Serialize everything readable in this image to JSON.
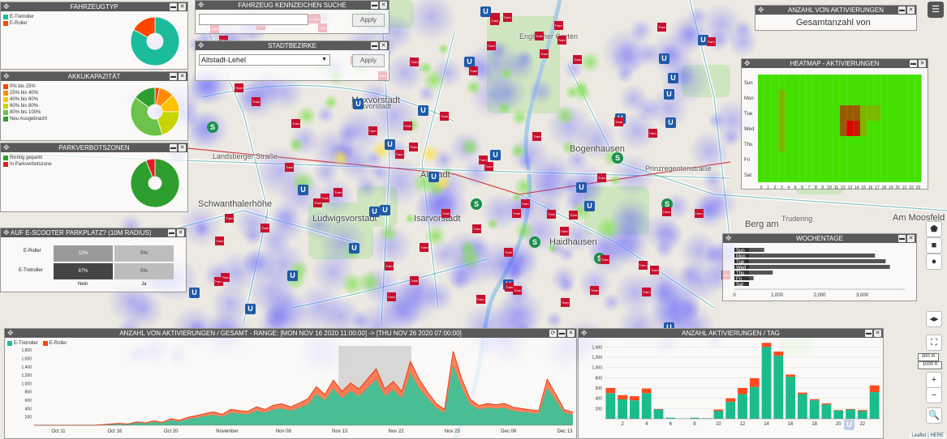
{
  "panels": {
    "vehicle_type": {
      "title": "FAHRZEUGTYP",
      "legend": [
        {
          "label": "E-Tretroller",
          "color": "#1abc9c"
        },
        {
          "label": "E-Roller",
          "color": "#ff4500"
        }
      ]
    },
    "battery": {
      "title": "AKKUKAPAZITÄT",
      "legend": [
        {
          "label": "0% bis 25%",
          "color": "#ff4500"
        },
        {
          "label": "25% bis 40%",
          "color": "#ff8c00"
        },
        {
          "label": "40% bis 60%",
          "color": "#ffc300"
        },
        {
          "label": "60% bis 80%",
          "color": "#c8d400"
        },
        {
          "label": "80% bis 100%",
          "color": "#6cc24a"
        },
        {
          "label": "Neu Ausgebracht",
          "color": "#2e9e2e"
        }
      ]
    },
    "parking_zones": {
      "title": "PARKVERBOTSZONEN",
      "legend": [
        {
          "label": "Richtig geparkt",
          "color": "#2e9e2e"
        },
        {
          "label": "In Parkverbotszone",
          "color": "#e02020"
        }
      ]
    },
    "parking_spot": {
      "title": "AUF E-SCOOTER PARKPLATZ? (10M RADIUS)",
      "rows": [
        "E-Roller",
        "E-Tretroller"
      ],
      "cols": [
        "Nein",
        "Ja"
      ],
      "cells": [
        [
          "12%",
          "0%"
        ],
        [
          "87%",
          "0%"
        ]
      ]
    },
    "plate_search": {
      "title": "FAHRZEUG KENNZEICHEN SUCHE",
      "placeholder": "",
      "apply": "Apply"
    },
    "districts": {
      "title": "STADTBEZIRKE",
      "selected": "Altstadt-Lehel",
      "apply": "Apply"
    },
    "activations_total": {
      "title": "ANZAHL VON AKTIVIERUNGEN",
      "subtitle": "Gesamtanzahl von"
    },
    "heatmap": {
      "title": "HEATMAP - AKTIVIERUNGEN"
    },
    "weekdays": {
      "title": "WOCHENTAGE"
    },
    "timeline": {
      "title": "ANZAHL VON AKTIVIERUNGEN / GESAMT - RANGE: [MON NOV 16 2020 11:00:00] -> [THU NOV 26 2020 07:00:00]",
      "legend": [
        {
          "label": "E-Tretroller",
          "color": "#1abc9c"
        },
        {
          "label": "E-Roller",
          "color": "#ff4500"
        }
      ]
    },
    "per_day": {
      "title": "ANZAHL AKTIVIERUNGEN / TAG"
    }
  },
  "map_labels": [
    {
      "text": "Maxvorstadt",
      "cls": "big"
    },
    {
      "text": "Altstadt",
      "cls": "big"
    },
    {
      "text": "Ludwigsvorstadt",
      "cls": "big"
    },
    {
      "text": "Isarvorstadt",
      "cls": "big"
    },
    {
      "text": "Haidhausen",
      "cls": "big"
    },
    {
      "text": "Bogenhausen",
      "cls": "big"
    },
    {
      "text": "Schwanthalerhöhe",
      "cls": "big"
    },
    {
      "text": "Berg am",
      "cls": "big"
    },
    {
      "text": "Am Moosfeld",
      "cls": "big"
    },
    {
      "text": "Maxvorstadt",
      "cls": ""
    },
    {
      "text": "Englischer Garten",
      "cls": ""
    },
    {
      "text": "Prinzregentenstraße",
      "cls": ""
    },
    {
      "text": "Landsberger Straße",
      "cls": ""
    },
    {
      "text": "Trudering",
      "cls": ""
    }
  ],
  "attribution": "Leaflet | HERE",
  "scale": {
    "metric": "300 m",
    "imperial": "1000 ft"
  },
  "map_controls": {
    "zoom_in": "+",
    "zoom_out": "−"
  },
  "chart_data": [
    {
      "type": "pie",
      "title": "FAHRZEUGTYP",
      "categories": [
        "E-Tretroller",
        "E-Roller"
      ],
      "values": [
        83,
        17
      ]
    },
    {
      "type": "pie",
      "title": "AKKUKAPAZITÄT",
      "categories": [
        "0% bis 25%",
        "25% bis 40%",
        "40% bis 60%",
        "60% bis 80%",
        "80% bis 100%",
        "Neu Ausgebracht"
      ],
      "values": [
        3,
        10,
        12,
        20,
        40,
        15
      ]
    },
    {
      "type": "pie",
      "title": "PARKVERBOTSZONEN",
      "categories": [
        "Richtig geparkt",
        "In Parkverbotszone"
      ],
      "values": [
        94,
        6
      ]
    },
    {
      "type": "bar",
      "title": "WOCHENTAGE",
      "categories": [
        "Sun",
        "Mon",
        "Tue",
        "Wed",
        "Thu",
        "Fri",
        "Sat"
      ],
      "values": [
        700,
        3300,
        3550,
        3650,
        900,
        450,
        250
      ],
      "xlim": [
        0,
        4000
      ],
      "xticks": [
        "0",
        "1,000",
        "2,000",
        "3,000"
      ]
    },
    {
      "type": "bar",
      "title": "ANZAHL AKTIVIERUNGEN / TAG",
      "categories": [
        "1",
        "2",
        "3",
        "4",
        "5",
        "6",
        "7",
        "8",
        "9",
        "10",
        "11",
        "12",
        "13",
        "14",
        "15",
        "16",
        "17",
        "18",
        "19",
        "20",
        "21",
        "22",
        "23"
      ],
      "xticks": [
        "2",
        "4",
        "6",
        "8",
        "10",
        "12",
        "14",
        "16",
        "18",
        "20",
        "22"
      ],
      "series": [
        {
          "name": "E-Tretroller",
          "values": [
            500,
            380,
            360,
            500,
            180,
            20,
            5,
            20,
            10,
            150,
            330,
            480,
            620,
            1400,
            1230,
            820,
            480,
            360,
            280,
            160,
            180,
            150,
            520
          ]
        },
        {
          "name": "E-Roller",
          "values": [
            100,
            80,
            80,
            90,
            10,
            0,
            0,
            0,
            0,
            30,
            70,
            120,
            170,
            80,
            80,
            40,
            30,
            20,
            20,
            10,
            10,
            20,
            130
          ]
        }
      ],
      "ylim": [
        0,
        1500
      ],
      "yticks": [
        "200",
        "400",
        "600",
        "800",
        "1,000",
        "1,200",
        "1,400"
      ]
    },
    {
      "type": "area",
      "title": "ANZAHL VON AKTIVIERUNGEN / GESAMT",
      "xticks": [
        "Oct 11",
        "Oct 16",
        "Oct 20",
        "November",
        "Nov 08",
        "Nov 13",
        "Nov 22",
        "Nov 25",
        "Dec 06",
        "Dec 13"
      ],
      "yticks": [
        "200",
        "400",
        "600",
        "800",
        "1,000",
        "1,200",
        "1,400",
        "1,600",
        "1,800"
      ],
      "ylim": [
        0,
        1900
      ],
      "selection": [
        "Nov 16",
        "Nov 26"
      ],
      "series": [
        {
          "name": "E-Tretroller",
          "values": [
            0,
            0,
            0,
            0,
            0,
            0,
            0,
            0,
            10,
            20,
            30,
            20,
            60,
            40,
            80,
            50,
            120,
            90,
            150,
            180,
            220,
            250,
            200,
            300,
            280,
            260,
            350,
            300,
            380,
            400,
            350,
            420,
            500,
            750,
            600,
            880,
            650,
            820,
            700,
            900,
            1100,
            700,
            850,
            650,
            1250,
            900,
            650,
            420,
            300,
            1450,
            900,
            500,
            380,
            420,
            400,
            420,
            350,
            320,
            300,
            280,
            900,
            600,
            300,
            250
          ]
        },
        {
          "name": "E-Roller",
          "values": [
            0,
            0,
            0,
            0,
            0,
            0,
            0,
            0,
            5,
            10,
            15,
            10,
            20,
            15,
            25,
            20,
            35,
            30,
            40,
            50,
            60,
            70,
            60,
            80,
            70,
            70,
            90,
            80,
            100,
            110,
            90,
            110,
            130,
            170,
            140,
            200,
            160,
            190,
            170,
            210,
            250,
            170,
            200,
            160,
            280,
            210,
            150,
            100,
            80,
            320,
            210,
            120,
            90,
            100,
            90,
            100,
            80,
            80,
            70,
            70,
            200,
            140,
            70,
            60
          ]
        }
      ]
    },
    {
      "type": "heatmap",
      "title": "HEATMAP - AKTIVIERUNGEN",
      "rows": [
        "Sun",
        "Mon",
        "Tue",
        "Wed",
        "Thu",
        "Fri",
        "Sat"
      ],
      "cols": [
        "0",
        "1",
        "2",
        "3",
        "4",
        "5",
        "6",
        "7",
        "8",
        "9",
        "10",
        "11",
        "12",
        "13",
        "14",
        "15",
        "16",
        "17",
        "18",
        "19",
        "20",
        "21",
        "22",
        "23"
      ],
      "hot_cells": [
        {
          "row": "Tue",
          "col": "12",
          "level": 0.4
        },
        {
          "row": "Tue",
          "col": "13",
          "level": 0.45
        },
        {
          "row": "Tue",
          "col": "14",
          "level": 0.4
        },
        {
          "row": "Tue",
          "col": "15",
          "level": 0.3
        },
        {
          "row": "Tue",
          "col": "16",
          "level": 0.25
        },
        {
          "row": "Tue",
          "col": "17",
          "level": 0.2
        },
        {
          "row": "Wed",
          "col": "13",
          "level": 1.0
        },
        {
          "row": "Wed",
          "col": "14",
          "level": 0.85
        },
        {
          "row": "Wed",
          "col": "12",
          "level": 0.35
        },
        {
          "row": "Wed",
          "col": "15",
          "level": 0.3
        },
        {
          "row": "Mon",
          "col": "3",
          "level": 0.15
        },
        {
          "row": "Tue",
          "col": "3",
          "level": 0.15
        },
        {
          "row": "Wed",
          "col": "3",
          "level": 0.15
        },
        {
          "row": "Thu",
          "col": "3",
          "level": 0.12
        }
      ]
    }
  ]
}
